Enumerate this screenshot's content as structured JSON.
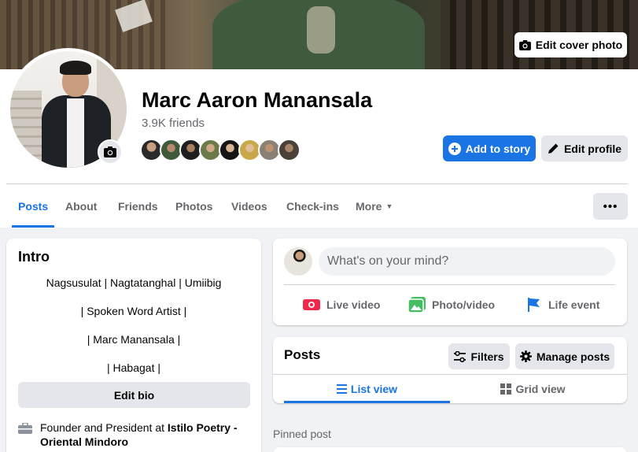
{
  "cover": {
    "edit_label": "Edit cover photo"
  },
  "profile": {
    "name": "Marc Aaron Manansala",
    "friends_count": "3.9K friends",
    "add_story_label": "Add to story",
    "edit_profile_label": "Edit profile"
  },
  "nav": {
    "tabs": [
      {
        "label": "Posts",
        "active": true
      },
      {
        "label": "About"
      },
      {
        "label": "Friends"
      },
      {
        "label": "Photos"
      },
      {
        "label": "Videos"
      },
      {
        "label": "Check-ins"
      },
      {
        "label": "More"
      }
    ],
    "menu_icon": "ellipsis-icon"
  },
  "intro": {
    "title": "Intro",
    "bio_lines": [
      "Nagsusulat | Nagtatanghal | Umiibig",
      "| Spoken Word Artist |",
      "| Marc Manansala |",
      "| Habagat |"
    ],
    "edit_bio_label": "Edit bio",
    "work_prefix": "Founder and President at ",
    "work_org": "Istilo Poetry - Oriental Mindoro"
  },
  "composer": {
    "placeholder": "What's on your mind?",
    "actions": [
      {
        "label": "Live video",
        "icon": "live-video-icon",
        "color": "#f02849"
      },
      {
        "label": "Photo/video",
        "icon": "photo-video-icon",
        "color": "#45bd62"
      },
      {
        "label": "Life event",
        "icon": "life-event-flag-icon",
        "color": "#1b74e4"
      }
    ]
  },
  "posts": {
    "title": "Posts",
    "filters_label": "Filters",
    "manage_label": "Manage posts",
    "list_view_label": "List view",
    "grid_view_label": "Grid view",
    "pinned_label": "Pinned post"
  },
  "colors": {
    "accent": "#1b74e4",
    "background": "#f0f2f5",
    "secondary_button": "#e4e6eb"
  }
}
